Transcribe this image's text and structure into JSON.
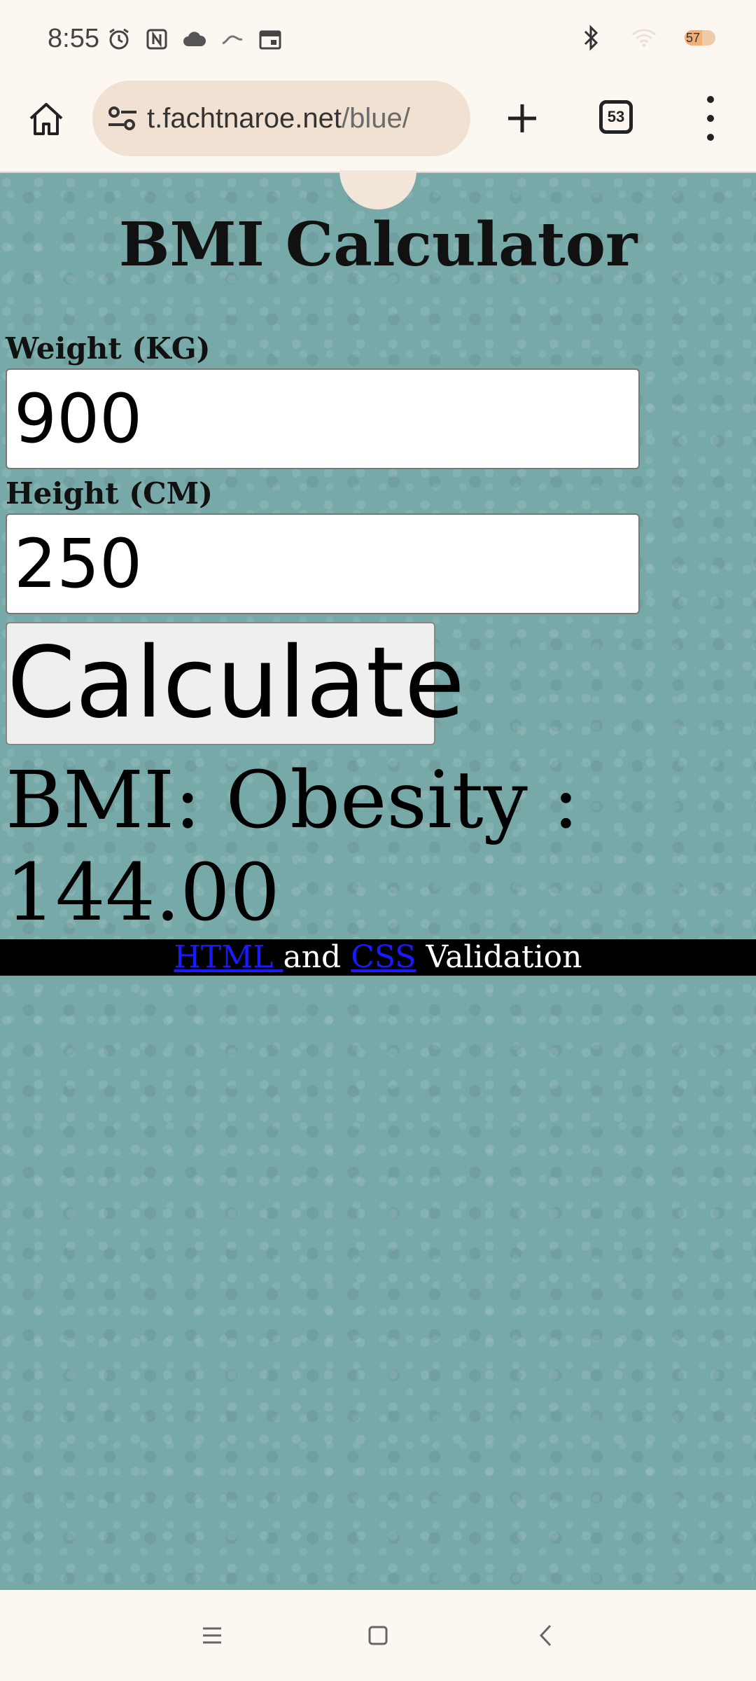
{
  "status_bar": {
    "time": "8:55",
    "battery": {
      "label": "57",
      "level_percent": 57
    },
    "icons": [
      "alarm-icon",
      "nfc-icon",
      "cloud-icon",
      "app-icon",
      "calendar-icon",
      "bluetooth-icon",
      "wifi-icon"
    ]
  },
  "browser": {
    "url_host": "t.fachtnaroe.net",
    "url_path": "/blue/",
    "tab_count": "53"
  },
  "page": {
    "title": "BMI Calculator",
    "weight_label": "Weight (KG)",
    "weight_value": "900",
    "height_label": "Height (CM)",
    "height_value": "250",
    "calculate_label": "Calculate",
    "result_text": "BMI: Obesity : 144.00",
    "footer": {
      "html_link": "HTML ",
      "and_text": "and ",
      "css_link": "CSS",
      "validation_text": " Validation"
    }
  },
  "colors": {
    "page_background": "#78a9a9",
    "browser_chrome": "#fcf7f1",
    "url_bar": "#f1e1d2",
    "link": "#1a1aff",
    "footer_bg": "#000000"
  }
}
